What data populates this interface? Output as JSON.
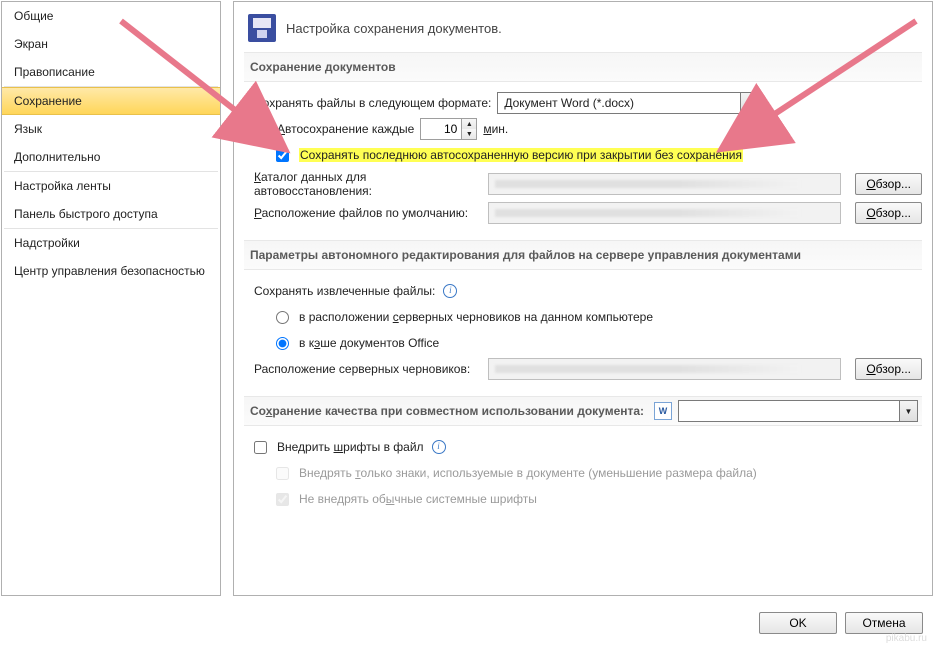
{
  "sidebar": {
    "items": [
      {
        "label": "Общие"
      },
      {
        "label": "Экран"
      },
      {
        "label": "Правописание"
      },
      {
        "label": "Сохранение",
        "selected": true
      },
      {
        "label": "Язык"
      },
      {
        "label": "Дополнительно"
      },
      {
        "label": "Настройка ленты"
      },
      {
        "label": "Панель быстрого доступа"
      },
      {
        "label": "Надстройки"
      },
      {
        "label": "Центр управления безопасностью"
      }
    ],
    "separators_after": [
      2,
      5,
      7
    ]
  },
  "header": {
    "title": "Настройка сохранения документов."
  },
  "groups": {
    "save_docs": {
      "title": "Сохранение документов",
      "format_label_pre": "Сохранять файлы в сле",
      "format_label_u": "д",
      "format_label_post": "ующем формате:",
      "format_value": "Документ Word (*.docx)",
      "autosave_pre": "",
      "autosave_u": "А",
      "autosave_post": "втосохранение каждые",
      "autosave_value": "10",
      "autosave_unit": "мин.",
      "autosave_unit_u": "м",
      "autosave_unit_post": "ин.",
      "keep_last_label": "Сохранять последнюю автосохраненную версию при закрытии без сохранения",
      "recover_label_u": "К",
      "recover_label_post": "аталог данных для автовосстановления:",
      "default_loc_u": "Р",
      "default_loc_post": "асположение файлов по умолчанию:",
      "browse": "Обзор...",
      "browse_u": "О",
      "browse_post": "бзор...",
      "browse2_post": "бзор..."
    },
    "offline": {
      "title": "Параметры автономного редактирования для файлов на сервере управления документами",
      "save_extracted": "Сохранять извлеченные файлы:",
      "radio1_pre": "в расположении ",
      "radio1_u": "с",
      "radio1_post": "ерверных черновиков на данном компьютере",
      "radio2_pre": "в к",
      "radio2_u": "э",
      "radio2_post": "ше документов Office",
      "drafts_label": "Расположение серверных черновиков:",
      "browse_u": "О",
      "browse_post": "бзор..."
    },
    "quality": {
      "title_pre": "Со",
      "title_u": "х",
      "title_post": "ранение качества при совместном использовании документа:",
      "embed_pre": "Внедрить ",
      "embed_u": "ш",
      "embed_post": "рифты в файл",
      "only_used_pre": "Внедрять ",
      "only_used_u": "т",
      "only_used_post": "олько знаки, используемые в документе (уменьшение размера файла)",
      "no_sys_pre": "Не внедрять об",
      "no_sys_u": "ы",
      "no_sys_post": "чные системные шрифты"
    }
  },
  "footer": {
    "ok": "OK",
    "cancel": "Отмена"
  },
  "watermark": "pikabu.ru"
}
